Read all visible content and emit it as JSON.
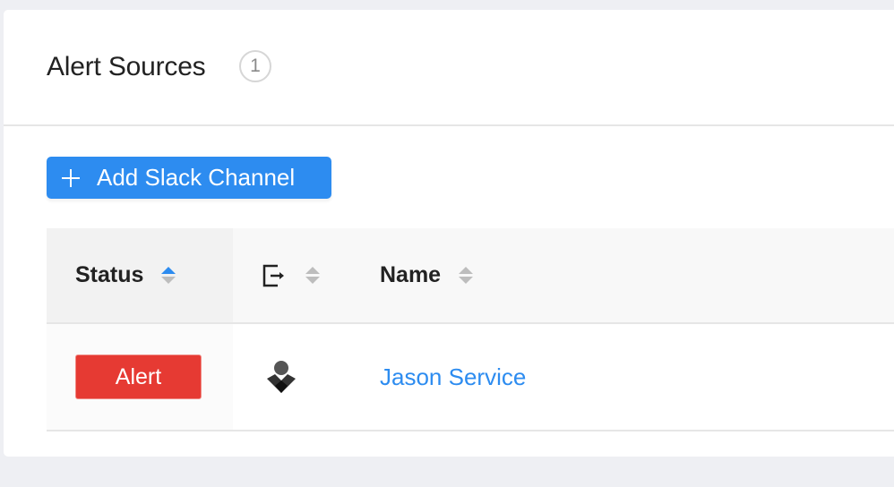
{
  "header": {
    "title": "Alert Sources",
    "count": "1"
  },
  "toolbar": {
    "add_label": "Add Slack Channel",
    "add_icon": "plus-icon"
  },
  "table": {
    "columns": [
      {
        "label": "Status",
        "sort": "ascending"
      },
      {
        "label": "",
        "icon": "source-export-icon",
        "sort": "none"
      },
      {
        "label": "Name",
        "sort": "none"
      }
    ],
    "rows": [
      {
        "status": "Alert",
        "source_icon": "opsgenie-icon",
        "name": "Jason Service"
      }
    ]
  },
  "colors": {
    "accent": "#2d8cf0",
    "alert": "#e63a33",
    "background": "#eeeff3"
  }
}
